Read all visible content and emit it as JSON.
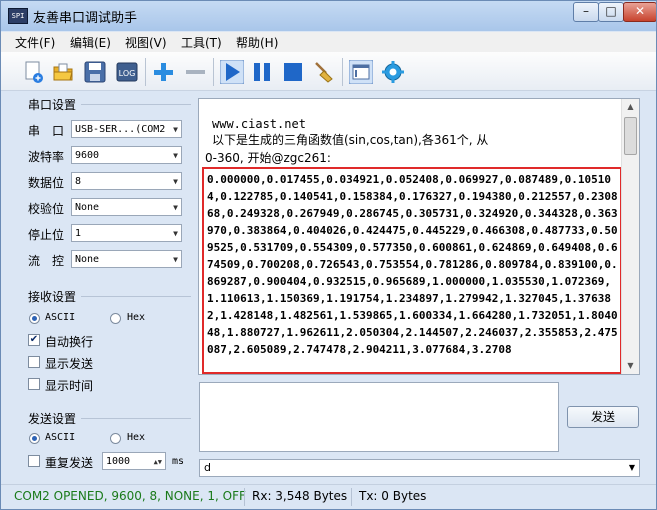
{
  "window": {
    "title": "友善串口调试助手",
    "app_icon_text": "SPI",
    "min": "–",
    "max": "□",
    "close": "✕"
  },
  "menu": [
    "文件(F)",
    "编辑(E)",
    "视图(V)",
    "工具(T)",
    "帮助(H)"
  ],
  "toolbar": {
    "icons": [
      "new-document-icon",
      "open-folder-icon",
      "save-icon",
      "log-icon",
      "add-icon",
      "remove-icon",
      "play-icon",
      "pause-icon",
      "stop-icon",
      "clear-broom-icon",
      "window-icon",
      "settings-gear-icon"
    ],
    "log_label": "LOG"
  },
  "serial_settings": {
    "title": "串口设置",
    "fields": [
      {
        "label": "串　口",
        "value": "USB-SER...(COM2"
      },
      {
        "label": "波特率",
        "value": "9600"
      },
      {
        "label": "数据位",
        "value": "8"
      },
      {
        "label": "校验位",
        "value": "None"
      },
      {
        "label": "停止位",
        "value": "1"
      },
      {
        "label": "流　控",
        "value": "None"
      }
    ]
  },
  "receive_settings": {
    "title": "接收设置",
    "ascii": "ASCII",
    "hex": "Hex",
    "selected": "ASCII",
    "auto_wrap": "自动换行",
    "auto_wrap_checked": true,
    "show_send": "显示发送",
    "show_send_checked": false,
    "show_time": "显示时间",
    "show_time_checked": false
  },
  "send_settings": {
    "title": "发送设置",
    "ascii": "ASCII",
    "hex": "Hex",
    "selected": "ASCII",
    "repeat": "重复发送",
    "repeat_checked": false,
    "interval": "1000",
    "unit": "ms"
  },
  "receive_area": {
    "line1": "www.ciast.net",
    "line2": "以下是生成的三角函数值(sin,cos,tan),各361个, 从",
    "line3": "0-360, 开始@zgc261:",
    "data": "0.000000,0.017455,0.034921,0.052408,0.069927,0.087489,0.105104,0.122785,0.140541,0.158384,0.176327,0.194380,0.212557,0.230868,0.249328,0.267949,0.286745,0.305731,0.324920,0.344328,0.363970,0.383864,0.404026,0.424475,0.445229,0.466308,0.487733,0.509525,0.531709,0.554309,0.577350,0.600861,0.624869,0.649408,0.674509,0.700208,0.726543,0.753554,0.781286,0.809784,0.839100,0.869287,0.900404,0.932515,0.965689,1.000000,1.035530,1.072369,1.110613,1.150369,1.191754,1.234897,1.279942,1.327045,1.376382,1.428148,1.482561,1.539865,1.600334,1.664280,1.732051,1.804048,1.880727,1.962611,2.050304,2.144507,2.246037,2.355853,2.475087,2.605089,2.747478,2.904211,3.077684,3.2708"
  },
  "send_area": {
    "button": "发送",
    "history_value": "d",
    "text": ""
  },
  "status": {
    "port": "COM2 OPENED, 9600, 8, NONE, 1, OFF",
    "rx": "Rx: 3,548 Bytes",
    "tx": "Tx: 0 Bytes",
    "port_color": "#1a7a1a"
  }
}
